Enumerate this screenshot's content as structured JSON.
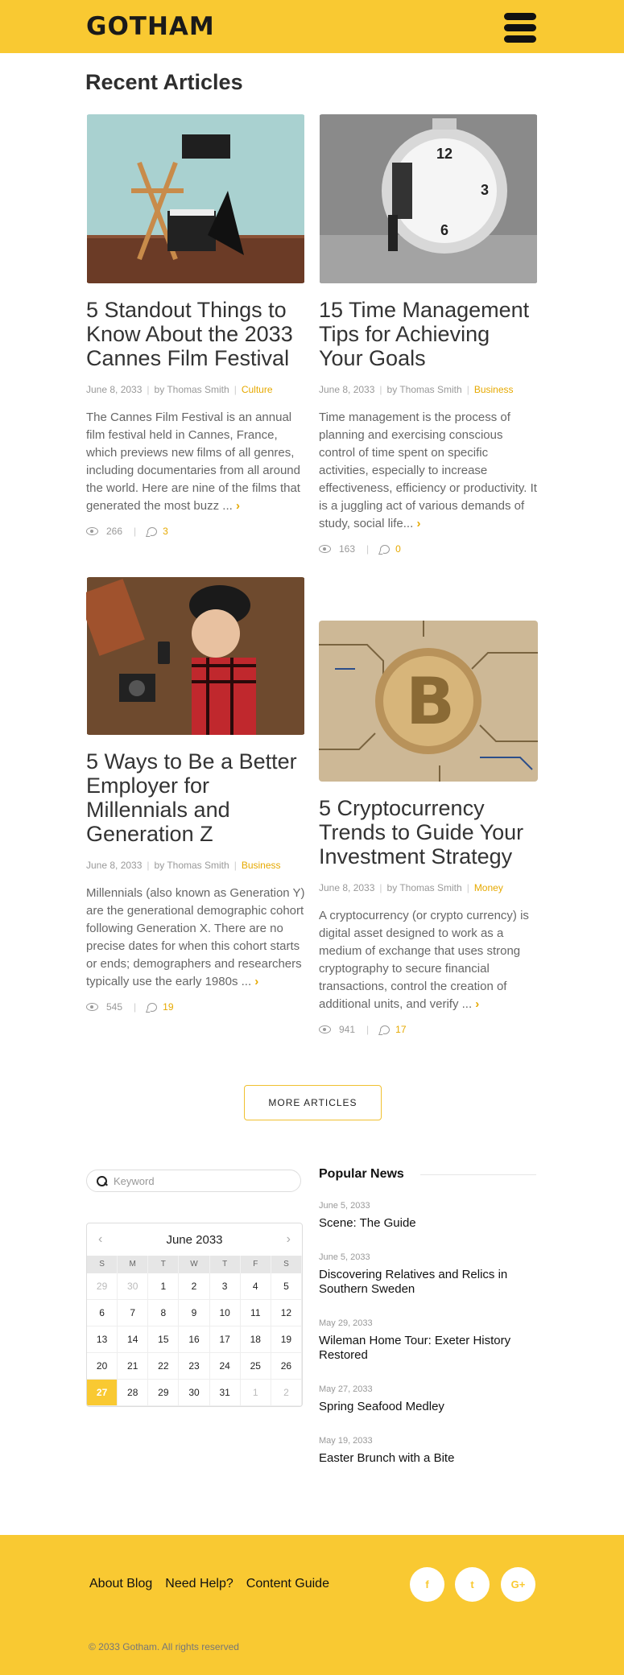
{
  "header": {
    "logo": "GOTHAM",
    "menu_icon": "hamburger-icon"
  },
  "section_title": "Recent Articles",
  "articles": [
    {
      "title": "5 Standout Things to Know About the 2033 Cannes Film Festival",
      "date": "June 8, 2033",
      "author": "by Thomas Smith",
      "category": "Culture",
      "excerpt": "The Cannes Film Festival is an annual film festival held in Cannes, France, which previews new films of all genres, including documentaries from all around the world. Here are nine of the films that generated the most buzz ...",
      "views": "266",
      "comments": "3",
      "image": "director-chair-clapperboard"
    },
    {
      "title": "15 Time Management Tips for Achieving Your Goals",
      "date": "June 8, 2033",
      "author": "by Thomas Smith",
      "category": "Business",
      "excerpt": "Time management is the process of planning and exercising conscious control of time spent on specific activities, especially to increase effectiveness, efficiency or productivity. It is a juggling act of various demands of study, social life...",
      "views": "163",
      "comments": "0",
      "image": "man-pushing-alarm-clock"
    },
    {
      "title": "5 Ways to Be a Better Employer for Millennials and Generation Z",
      "date": "June 8, 2033",
      "author": "by Thomas Smith",
      "category": "Business",
      "excerpt": "Millennials (also known as Generation Y) are the generational demographic cohort following Generation X. There are no precise dates for when this cohort starts or ends; demographers and researchers typically use the early 1980s ...",
      "views": "545",
      "comments": "19",
      "image": "woman-with-phone"
    },
    {
      "title": "5 Cryptocurrency Trends to Guide Your Investment Strategy",
      "date": "June 8, 2033",
      "author": "by Thomas Smith",
      "category": "Money",
      "excerpt": "A cryptocurrency (or crypto currency) is digital asset designed to work as a medium of exchange that uses strong cryptography to secure financial transactions, control the creation of additional units, and verify ...",
      "views": "941",
      "comments": "17",
      "image": "bitcoin-on-circuit-board"
    }
  ],
  "more_button": "MORE ARTICLES",
  "search": {
    "placeholder": "Keyword"
  },
  "calendar": {
    "month": "June 2033",
    "weekdays": [
      "S",
      "M",
      "T",
      "W",
      "T",
      "F",
      "S"
    ],
    "days": [
      "29",
      "30",
      "1",
      "2",
      "3",
      "4",
      "5",
      "6",
      "7",
      "8",
      "9",
      "10",
      "11",
      "12",
      "13",
      "14",
      "15",
      "16",
      "17",
      "18",
      "19",
      "20",
      "21",
      "22",
      "23",
      "24",
      "25",
      "26",
      "27",
      "28",
      "29",
      "30",
      "31",
      "1",
      "2"
    ],
    "muted": [
      0,
      1,
      33,
      34
    ],
    "active": 28
  },
  "popular": {
    "title": "Popular News",
    "items": [
      {
        "date": "June 5, 2033",
        "headline": "Scene: The Guide"
      },
      {
        "date": "June 5, 2033",
        "headline": "Discovering Relatives and Relics in Southern Sweden"
      },
      {
        "date": "May 29, 2033",
        "headline": "Wileman Home Tour: Exeter History Restored"
      },
      {
        "date": "May 27, 2033",
        "headline": "Spring Seafood Medley"
      },
      {
        "date": "May 19, 2033",
        "headline": "Easter Brunch with a Bite"
      }
    ]
  },
  "footer": {
    "links": [
      "About Blog",
      "Need Help?",
      "Content Guide"
    ],
    "social": [
      {
        "icon": "facebook-icon",
        "glyph": "f"
      },
      {
        "icon": "twitter-icon",
        "glyph": "t"
      },
      {
        "icon": "google-plus-icon",
        "glyph": "G+"
      }
    ],
    "copyright": "© 2033 Gotham. All rights reserved"
  },
  "colors": {
    "brand": "#f9c932",
    "accent": "#e6a900"
  }
}
